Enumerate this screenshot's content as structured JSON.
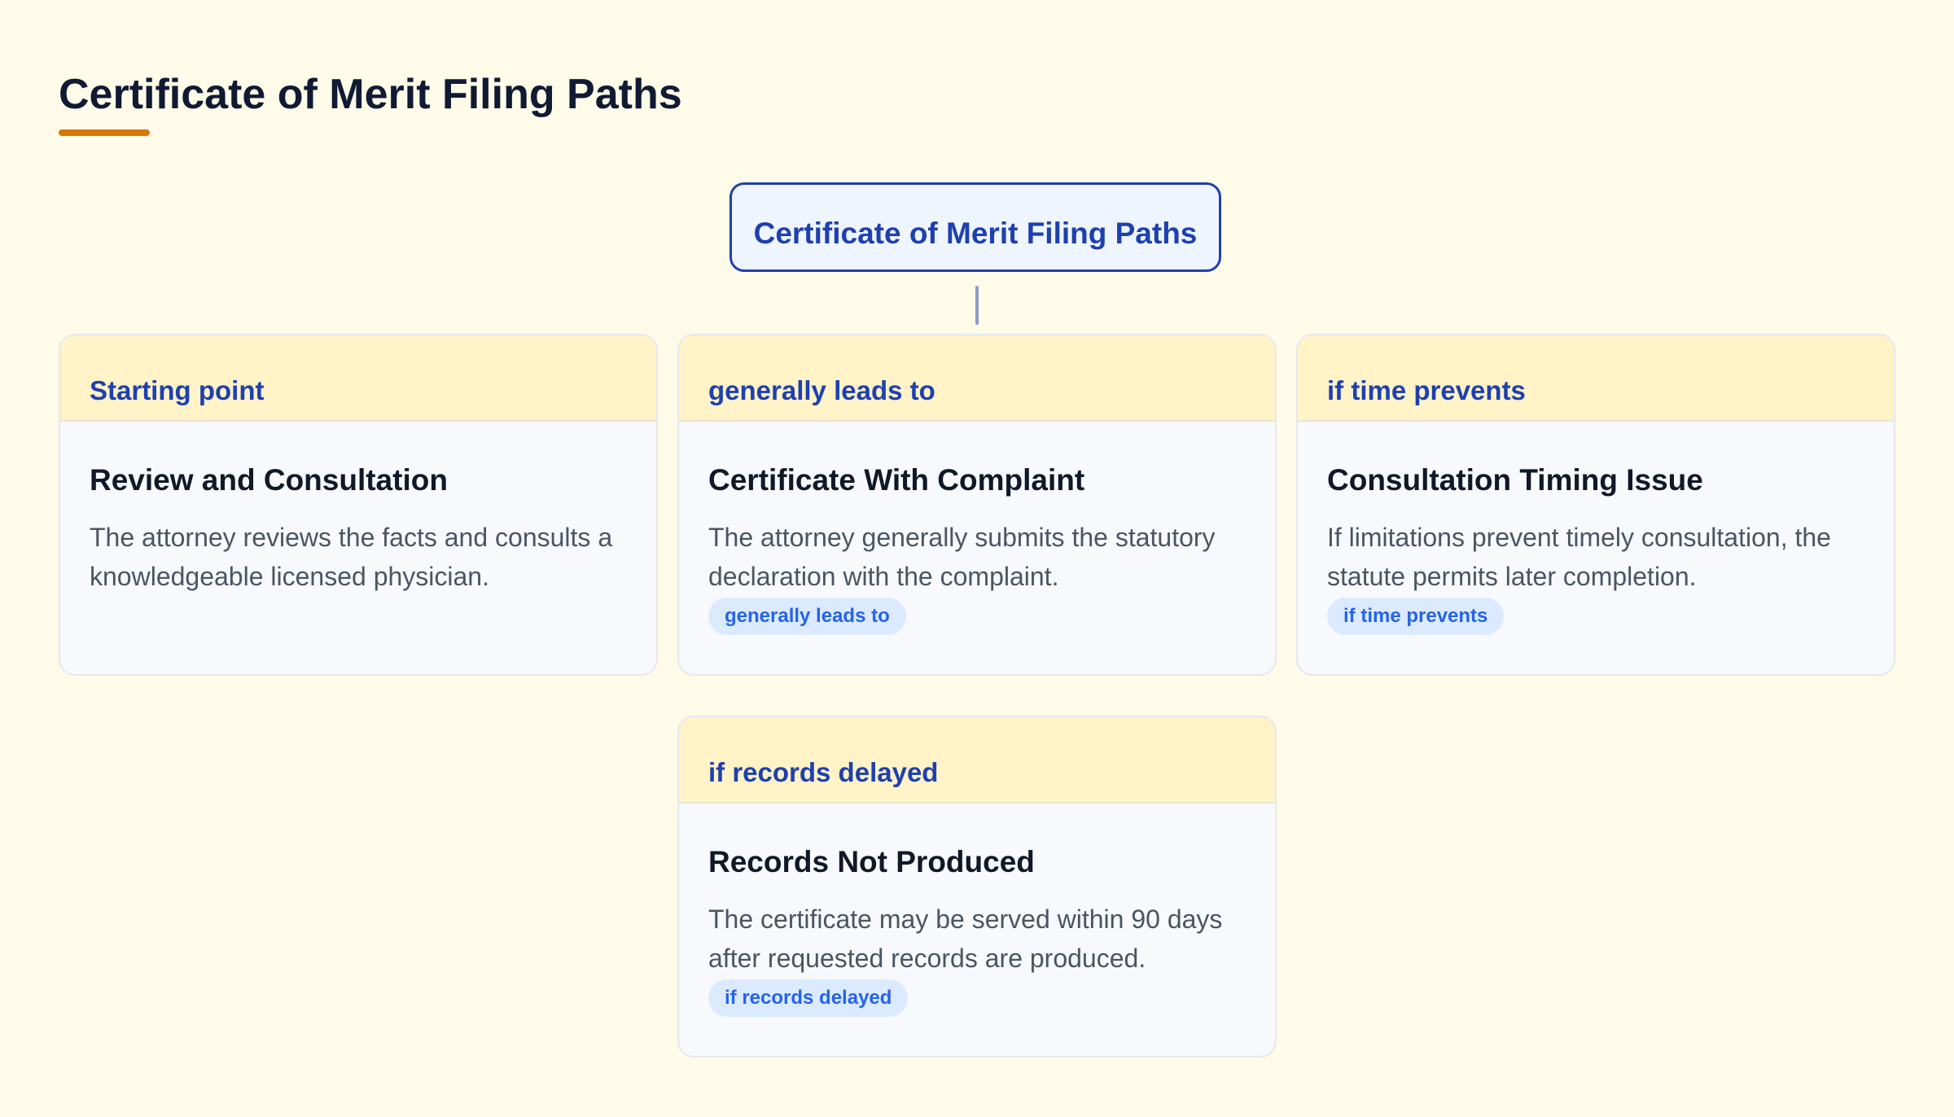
{
  "page": {
    "title": "Certificate of Merit Filing Paths"
  },
  "root": {
    "label": "Certificate of Merit Filing Paths"
  },
  "cards": [
    {
      "header": "Starting point",
      "title": "Review and Consultation",
      "description": "The attorney reviews the facts and consults a knowledgeable licensed physician.",
      "badge": ""
    },
    {
      "header": "generally leads to",
      "title": "Certificate With Complaint",
      "description": "The attorney generally submits the statutory declaration with the complaint.",
      "badge": "generally leads to"
    },
    {
      "header": "if time prevents",
      "title": "Consultation Timing Issue",
      "description": "If limitations prevent timely consultation, the statute permits later completion.",
      "badge": "if time prevents"
    },
    {
      "header": "if records delayed",
      "title": "Records Not Produced",
      "description": "The certificate may be served within 90 days after requested records are produced.",
      "badge": "if records delayed"
    }
  ],
  "colors": {
    "background": "#fefbe8",
    "accent_underline": "#d97706",
    "primary_blue": "#1e40af",
    "card_header_bg": "#fff3c7",
    "badge_bg": "#dbeafe",
    "badge_text": "#2563eb"
  }
}
